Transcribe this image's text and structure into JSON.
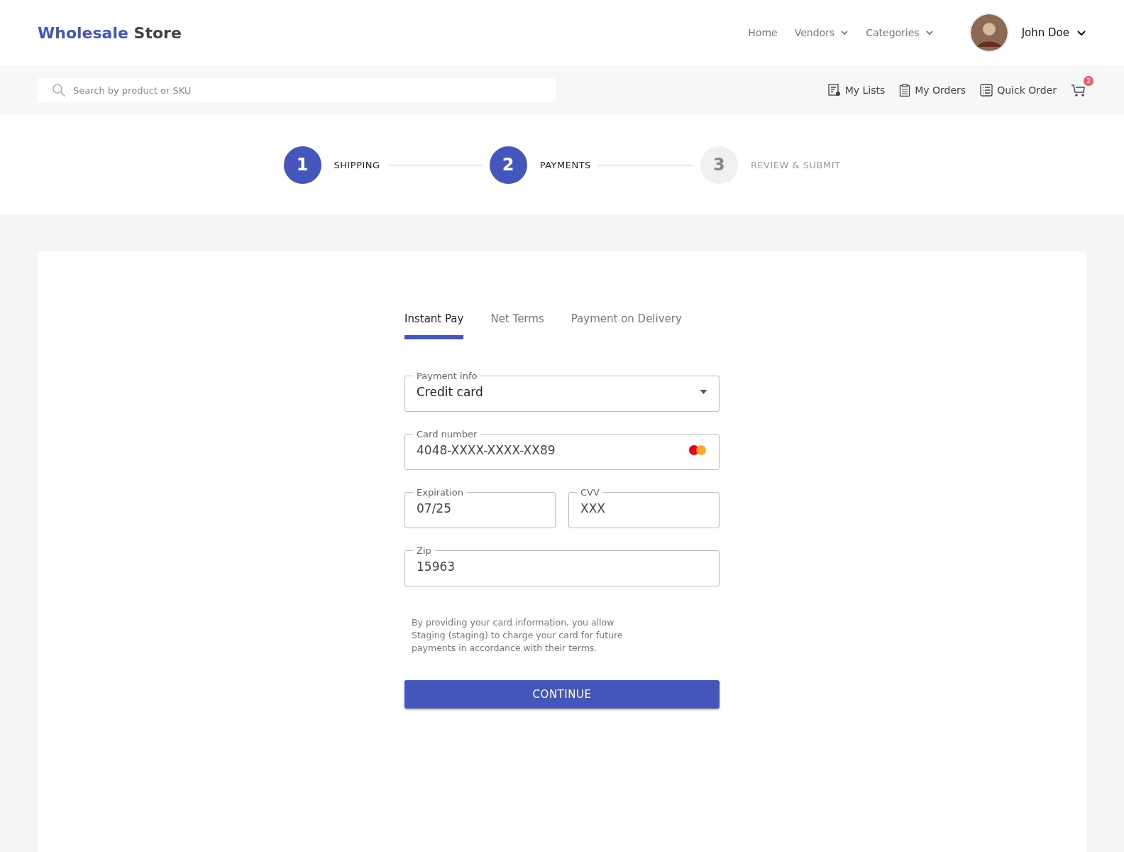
{
  "brand": {
    "first": "Wholesale",
    "second": "Store"
  },
  "nav": [
    {
      "label": "Home",
      "dropdown": false
    },
    {
      "label": "Vendors",
      "dropdown": true
    },
    {
      "label": "Categories",
      "dropdown": true
    }
  ],
  "user": {
    "name": "John Doe"
  },
  "search": {
    "placeholder": "Search by product or SKU"
  },
  "toolbar": [
    {
      "kind": "lists",
      "label": "My Lists"
    },
    {
      "kind": "orders",
      "label": "My Orders"
    },
    {
      "kind": "quick",
      "label": "Quick Order"
    }
  ],
  "cart": {
    "count": "2"
  },
  "steps": [
    {
      "number": "1",
      "label": "SHIPPING",
      "active": true
    },
    {
      "number": "2",
      "label": "PAYMENTS",
      "active": true
    },
    {
      "number": "3",
      "label": "REVIEW & SUBMIT",
      "active": false
    }
  ],
  "tabs": [
    {
      "label": "Instant Pay",
      "selected": true
    },
    {
      "label": "Net Terms",
      "selected": false
    },
    {
      "label": "Payment on Delivery",
      "selected": false
    }
  ],
  "form_rows": [
    [
      {
        "kind": "select",
        "label": "Payment info",
        "value": "Credit card"
      }
    ],
    [
      {
        "kind": "card",
        "label": "Card number",
        "value": "4048-XXXX-XXXX-XX89"
      }
    ],
    [
      {
        "kind": "text",
        "label": "Expiration",
        "value": "07/25"
      },
      {
        "kind": "text",
        "label": "CVV",
        "value": "XXX"
      }
    ],
    [
      {
        "kind": "text",
        "label": "Zip",
        "value": "15963"
      }
    ]
  ],
  "notice": "By providing your card information, you allow Staging (staging) to charge your card for future payments in accordance with their terms.",
  "submit": "CONTINUE"
}
